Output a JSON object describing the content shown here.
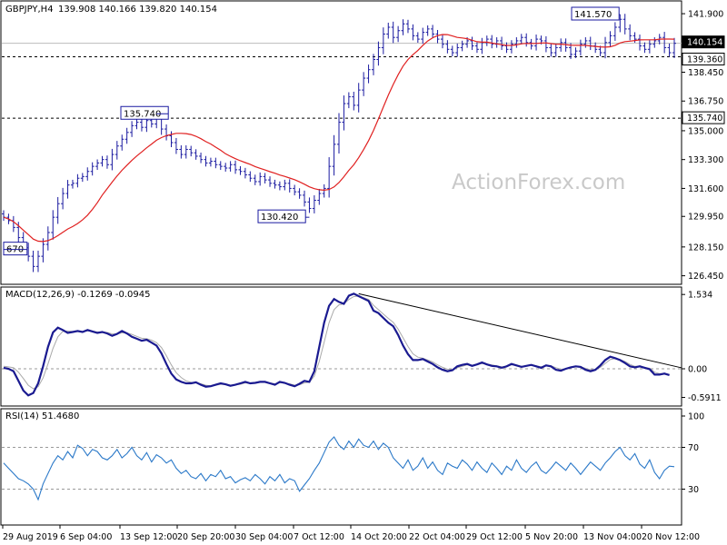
{
  "chart_data": [
    {
      "panel": "price",
      "type": "candlestick",
      "title": "GBPJPY,H4",
      "ohlc_label": "139.908 140.166 139.820 140.154",
      "ylim": [
        126.0,
        142.6
      ],
      "y_ticks": [
        "141.900",
        "138.450",
        "136.750",
        "135.000",
        "133.300",
        "131.600",
        "129.950",
        "128.150",
        "126.450"
      ],
      "grid": false,
      "x_labels": [
        "29 Aug 2019",
        "6 Sep 04:00",
        "13 Sep 12:00",
        "20 Sep 20:00",
        "30 Sep 04:00",
        "7 Oct 12:00",
        "14 Oct 20:00",
        "22 Oct 04:00",
        "29 Oct 12:00",
        "5 Nov 20:00",
        "13 Nov 04:00",
        "20 Nov 12:00"
      ],
      "close": [
        129.9,
        129.7,
        129.3,
        128.7,
        128.1,
        127.6,
        127.0,
        127.6,
        128.3,
        129.0,
        129.9,
        130.7,
        131.3,
        131.8,
        131.9,
        132.2,
        132.3,
        132.6,
        132.9,
        133.1,
        133.3,
        133.0,
        133.6,
        134.1,
        134.5,
        134.9,
        135.3,
        135.5,
        135.2,
        135.6,
        135.4,
        135.74,
        135.1,
        134.7,
        134.3,
        133.9,
        133.6,
        133.9,
        133.7,
        133.5,
        133.3,
        133.1,
        133.2,
        133.0,
        132.9,
        132.8,
        133.0,
        132.7,
        132.6,
        132.4,
        132.2,
        132.0,
        132.3,
        132.1,
        131.9,
        131.8,
        131.7,
        131.9,
        131.6,
        131.4,
        131.2,
        130.8,
        130.42,
        130.9,
        131.3,
        131.6,
        132.9,
        134.2,
        135.5,
        136.6,
        137.0,
        136.5,
        137.4,
        138.1,
        138.6,
        139.2,
        139.9,
        140.7,
        141.1,
        140.5,
        140.9,
        141.3,
        141.0,
        140.6,
        140.4,
        140.8,
        141.0,
        140.7,
        140.4,
        140.1,
        139.8,
        139.6,
        139.9,
        140.1,
        140.3,
        140.0,
        139.8,
        140.2,
        140.4,
        140.1,
        140.3,
        140.0,
        139.8,
        140.1,
        140.3,
        140.5,
        140.2,
        140.0,
        140.4,
        140.3,
        139.9,
        139.6,
        139.9,
        140.2,
        139.9,
        139.5,
        139.7,
        140.1,
        140.3,
        140.0,
        139.8,
        139.6,
        140.2,
        140.6,
        141.1,
        141.57,
        141.0,
        140.6,
        140.4,
        140.0,
        139.8,
        140.1,
        140.3,
        140.5,
        139.9,
        139.6,
        140.154
      ],
      "ma_label_values": [
        140.154
      ],
      "ma_color": "#e02020",
      "candle_color": "#1a1aa0",
      "level_lines": [
        139.36,
        135.74
      ],
      "annotations": [
        "670",
        "135.740",
        "130.420",
        "141.570"
      ],
      "price_badges": [
        "140.154",
        "139.360",
        "135.740"
      ],
      "watermark": "ActionForex.com"
    },
    {
      "panel": "macd",
      "type": "line",
      "title": "MACD(12,26,9) -0.1269 -0.0945",
      "ylim": [
        -0.75,
        1.65
      ],
      "y_ticks": [
        "1.534",
        "0.00",
        "-0.5911"
      ],
      "macd_color": "#1a1a90",
      "signal_color": "#aaaaaa",
      "trendline_color": "#000000",
      "macd": [
        0.02,
        0.0,
        -0.05,
        -0.25,
        -0.45,
        -0.55,
        -0.5,
        -0.3,
        0.05,
        0.45,
        0.75,
        0.85,
        0.8,
        0.74,
        0.76,
        0.78,
        0.76,
        0.8,
        0.77,
        0.74,
        0.76,
        0.73,
        0.68,
        0.72,
        0.78,
        0.73,
        0.66,
        0.62,
        0.58,
        0.6,
        0.54,
        0.48,
        0.32,
        0.1,
        -0.1,
        -0.22,
        -0.27,
        -0.3,
        -0.3,
        -0.28,
        -0.33,
        -0.37,
        -0.36,
        -0.33,
        -0.3,
        -0.32,
        -0.35,
        -0.33,
        -0.3,
        -0.27,
        -0.3,
        -0.29,
        -0.27,
        -0.27,
        -0.3,
        -0.33,
        -0.27,
        -0.29,
        -0.33,
        -0.36,
        -0.31,
        -0.25,
        -0.27,
        -0.05,
        0.45,
        0.95,
        1.3,
        1.44,
        1.38,
        1.34,
        1.51,
        1.55,
        1.5,
        1.45,
        1.4,
        1.2,
        1.15,
        1.05,
        0.95,
        0.88,
        0.7,
        0.48,
        0.3,
        0.18,
        0.18,
        0.2,
        0.15,
        0.1,
        0.03,
        -0.02,
        -0.05,
        -0.03,
        0.05,
        0.08,
        0.1,
        0.06,
        0.09,
        0.13,
        0.09,
        0.06,
        0.05,
        0.02,
        0.05,
        0.1,
        0.07,
        0.04,
        0.06,
        0.08,
        0.05,
        0.02,
        0.07,
        0.05,
        -0.02,
        -0.04,
        0.0,
        0.03,
        0.05,
        0.04,
        -0.02,
        -0.05,
        -0.02,
        0.07,
        0.18,
        0.25,
        0.22,
        0.18,
        0.12,
        0.05,
        0.03,
        0.05,
        0.02,
        -0.01,
        -0.12,
        -0.12,
        -0.1,
        -0.13
      ],
      "signal": [
        0.05,
        0.04,
        0.02,
        -0.07,
        -0.2,
        -0.34,
        -0.41,
        -0.37,
        -0.19,
        0.1,
        0.42,
        0.66,
        0.77,
        0.78,
        0.77,
        0.77,
        0.77,
        0.78,
        0.78,
        0.76,
        0.76,
        0.75,
        0.72,
        0.72,
        0.74,
        0.74,
        0.71,
        0.67,
        0.63,
        0.62,
        0.59,
        0.54,
        0.44,
        0.27,
        0.08,
        -0.08,
        -0.18,
        -0.25,
        -0.28,
        -0.29,
        -0.31,
        -0.34,
        -0.35,
        -0.34,
        -0.32,
        -0.32,
        -0.34,
        -0.33,
        -0.32,
        -0.29,
        -0.3,
        -0.29,
        -0.28,
        -0.28,
        -0.29,
        -0.31,
        -0.29,
        -0.29,
        -0.31,
        -0.34,
        -0.33,
        -0.29,
        -0.28,
        -0.15,
        0.15,
        0.55,
        0.95,
        1.22,
        1.32,
        1.34,
        1.43,
        1.49,
        1.5,
        1.47,
        1.43,
        1.31,
        1.22,
        1.13,
        1.04,
        0.96,
        0.82,
        0.64,
        0.46,
        0.31,
        0.24,
        0.22,
        0.18,
        0.14,
        0.08,
        0.03,
        -0.01,
        -0.02,
        0.02,
        0.05,
        0.08,
        0.07,
        0.08,
        0.11,
        0.1,
        0.08,
        0.06,
        0.04,
        0.05,
        0.08,
        0.07,
        0.05,
        0.06,
        0.07,
        0.06,
        0.04,
        0.06,
        0.06,
        0.02,
        -0.01,
        0.0,
        0.02,
        0.04,
        0.04,
        0.01,
        -0.02,
        -0.02,
        0.03,
        0.11,
        0.19,
        0.21,
        0.19,
        0.15,
        0.09,
        0.05,
        0.05,
        0.03,
        0.01,
        -0.07,
        -0.1,
        -0.1,
        -0.12
      ],
      "trendline": [
        [
          72,
          1.55
        ],
        [
          136,
          0.02
        ]
      ]
    },
    {
      "panel": "rsi",
      "type": "line",
      "title": "RSI(14) 51.4680",
      "ylim": [
        0,
        100
      ],
      "y_ticks": [
        "100",
        "70",
        "30"
      ],
      "levels": [
        70,
        30
      ],
      "rsi_color": "#2a78c8",
      "rsi": [
        55,
        50,
        45,
        40,
        38,
        35,
        30,
        20,
        35,
        45,
        55,
        62,
        58,
        66,
        60,
        72,
        69,
        62,
        68,
        66,
        60,
        58,
        62,
        68,
        60,
        64,
        70,
        62,
        58,
        65,
        56,
        63,
        60,
        55,
        58,
        50,
        45,
        48,
        42,
        40,
        45,
        38,
        44,
        42,
        48,
        40,
        42,
        36,
        39,
        41,
        38,
        44,
        40,
        35,
        42,
        38,
        44,
        36,
        40,
        38,
        28,
        34,
        40,
        48,
        55,
        65,
        75,
        80,
        72,
        68,
        76,
        70,
        78,
        72,
        70,
        76,
        68,
        74,
        70,
        60,
        55,
        50,
        58,
        48,
        52,
        60,
        50,
        56,
        48,
        44,
        55,
        52,
        50,
        58,
        54,
        48,
        56,
        50,
        46,
        55,
        50,
        44,
        52,
        48,
        58,
        50,
        46,
        52,
        56,
        48,
        45,
        50,
        56,
        52,
        48,
        55,
        50,
        44,
        50,
        56,
        52,
        48,
        55,
        60,
        66,
        70,
        62,
        58,
        64,
        54,
        50,
        58,
        46,
        40,
        48,
        52,
        51.468
      ],
      "x_labels_shared": true
    }
  ]
}
